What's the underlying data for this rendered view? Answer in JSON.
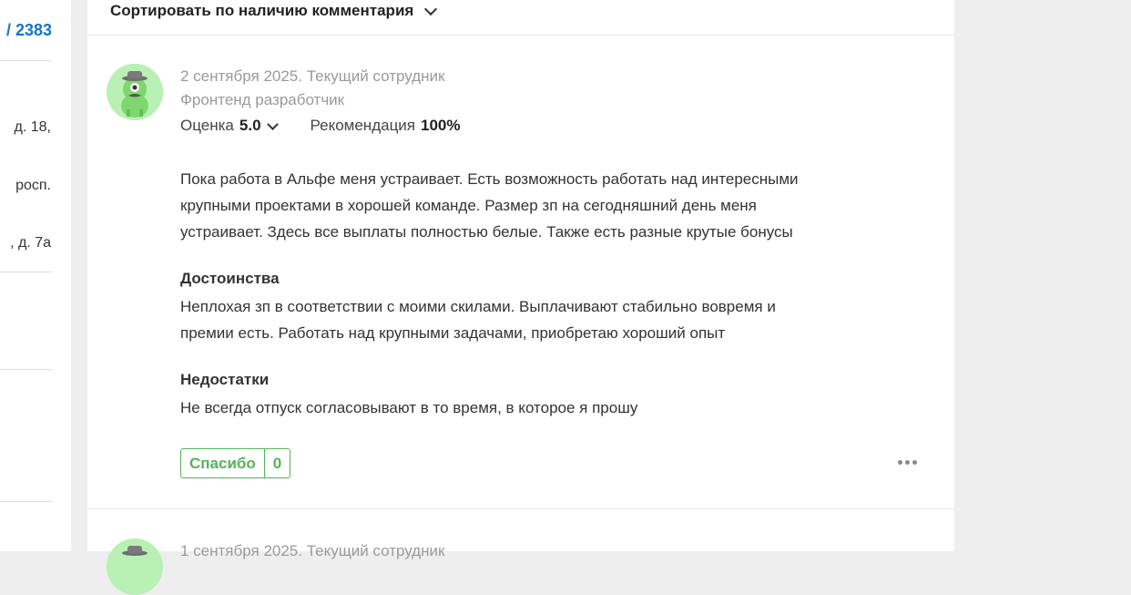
{
  "sidebar": {
    "count": "/ 2383",
    "address_fragments": [
      "д. 18,",
      "росп.",
      ", д. 7а"
    ]
  },
  "sort": {
    "label": "Сортировать по наличию комментария"
  },
  "review": {
    "date_status": "2 сентября 2025. Текущий сотрудник",
    "position": "Фронтенд разработчик",
    "rating_label": "Оценка",
    "rating_value": "5.0",
    "recommend_label": "Рекомендация",
    "recommend_value": "100%",
    "body": [
      "Пока работа в Альфе меня устраивает. Есть возможность работать над интересными",
      "крупными проектами в хорошей команде. Размер зп на сегодняшний день меня",
      "устраивает. Здесь все выплаты полностью белые. Также есть разные крутые бонусы"
    ],
    "pros_heading": "Достоинства",
    "pros": [
      "Неплохая зп в соответствии с моими скилами. Выплачивают стабильно вовремя и",
      "премии есть. Работать над крупными задачами, приобретаю хороший опыт"
    ],
    "cons_heading": "Недостатки",
    "cons": "Не всегда отпуск согласовывают в то время, в которое я прошу",
    "thanks_label": "Спасибо",
    "thanks_count": "0"
  },
  "next_review": {
    "date_status": "1 сентября 2025. Текущий сотрудник"
  },
  "colors": {
    "accent_green": "#56b35a",
    "link_blue": "#1a73c8",
    "avatar_bg": "#b9f0b4"
  },
  "icons": {
    "sort_toggle": "chevron-down-icon",
    "rating_toggle": "chevron-down-icon",
    "more": "more-horizontal-icon",
    "avatar": "spy-mascot-avatar"
  }
}
